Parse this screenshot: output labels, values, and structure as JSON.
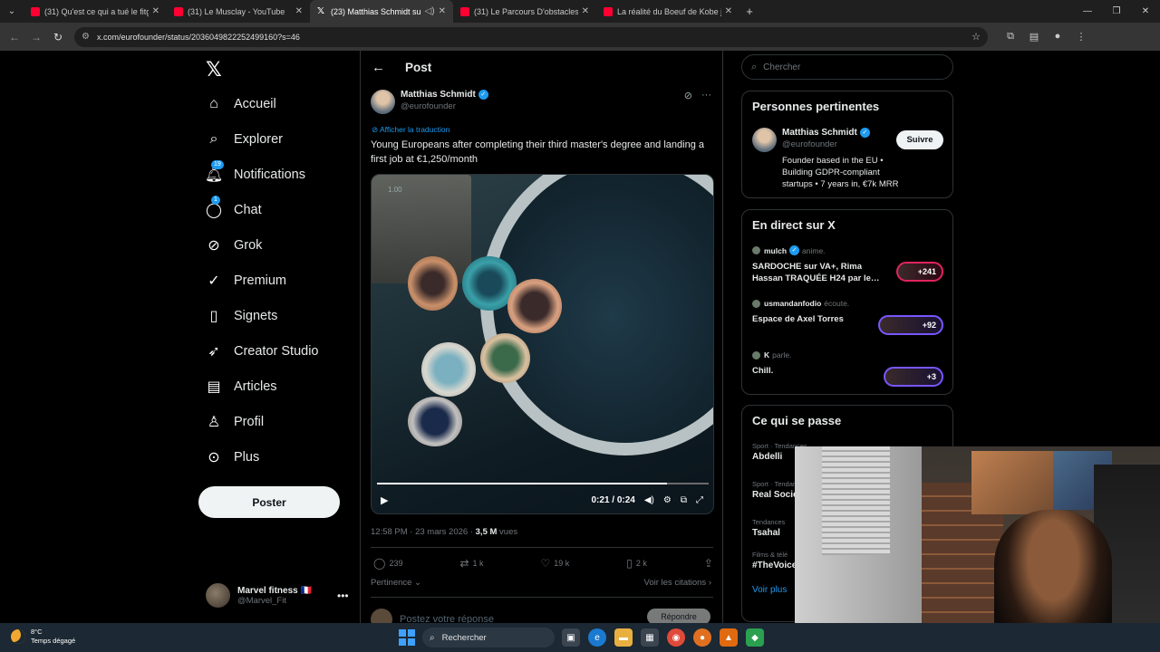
{
  "browser": {
    "tabs": [
      {
        "title": "(31) Qu'est ce qui a tué le fitgen",
        "active": false
      },
      {
        "title": "(31) Le Musclay - YouTube",
        "active": false
      },
      {
        "title": "(23) Matthias Schmidt sur X",
        "active": true
      },
      {
        "title": "(31) Le Parcours D'obstacles Le",
        "active": false
      },
      {
        "title": "La réalité du Boeuf de Kobe jap",
        "active": false
      }
    ],
    "url": "x.com/eurofounder/status/2036049822252499160?s=46"
  },
  "nav": {
    "items": [
      {
        "label": "Accueil",
        "icon": "home-icon"
      },
      {
        "label": "Explorer",
        "icon": "search-icon"
      },
      {
        "label": "Notifications",
        "icon": "bell-icon",
        "badge": "19"
      },
      {
        "label": "Chat",
        "icon": "chat-icon",
        "badge": "1"
      },
      {
        "label": "Grok",
        "icon": "grok-icon"
      },
      {
        "label": "Premium",
        "icon": "premium-icon"
      },
      {
        "label": "Signets",
        "icon": "bookmark-icon"
      },
      {
        "label": "Creator Studio",
        "icon": "rocket-icon"
      },
      {
        "label": "Articles",
        "icon": "article-icon"
      },
      {
        "label": "Profil",
        "icon": "person-icon"
      },
      {
        "label": "Plus",
        "icon": "more-circle-icon"
      }
    ],
    "post_button": "Poster",
    "account": {
      "name": "Marvel fitness 🇫🇷",
      "handle": "@Marvel_Fit"
    }
  },
  "post": {
    "header": "Post",
    "author": {
      "name": "Matthias Schmidt",
      "handle": "@eurofounder"
    },
    "translate": "Afficher la traduction",
    "text": "Young Europeans after completing their third master's degree and landing a first job at €1,250/month",
    "video": {
      "speed": "1.00",
      "time": "0:21 / 0:24",
      "progress": 0.875
    },
    "meta_time": "12:58 PM · 23 mars 2026 · ",
    "views_count": "3,5 M",
    "views_label": " vues",
    "stats": {
      "replies": "239",
      "reposts": "1 k",
      "likes": "19 k",
      "bookmarks": "2 k"
    },
    "sort": "Pertinence",
    "citations": "Voir les citations",
    "reply_placeholder": "Postez votre réponse",
    "reply_button": "Répondre"
  },
  "sidebar": {
    "search_placeholder": "Chercher",
    "relevant": {
      "title": "Personnes pertinentes",
      "name": "Matthias Schmidt",
      "handle": "@eurofounder",
      "follow": "Suivre",
      "bio": "Founder based in the EU • Building GDPR-compliant startups • 7 years in, €7k MRR"
    },
    "live": {
      "title": "En direct sur X",
      "items": [
        {
          "host": "mulch",
          "status": "anime.",
          "title": "SARDOCHE sur VA+, Rima Hassan TRAQUÉE H24 par le…",
          "count": "+241",
          "color": "#e0245e"
        },
        {
          "host": "usmandanfodio",
          "status": "écoute.",
          "title": "Espace de Axel Torres",
          "count": "+92",
          "color": "#7856ff"
        },
        {
          "host": "K",
          "status": "parle.",
          "title": "Chill.",
          "count": "+3",
          "color": "#7856ff"
        }
      ]
    },
    "trends": {
      "title": "Ce qui se passe",
      "items": [
        {
          "category": "Sport · Tendances",
          "name": "Abdelli"
        },
        {
          "category": "Sport · Tendances",
          "name": "Real Sociedad"
        },
        {
          "category": "Tendances",
          "name": "Tsahal"
        },
        {
          "category": "Films & télé",
          "name": "#TheVoice"
        }
      ],
      "more": "Voir plus"
    }
  },
  "taskbar": {
    "temp": "8°C",
    "weather": "Temps dégagé",
    "search": "Rechercher"
  }
}
